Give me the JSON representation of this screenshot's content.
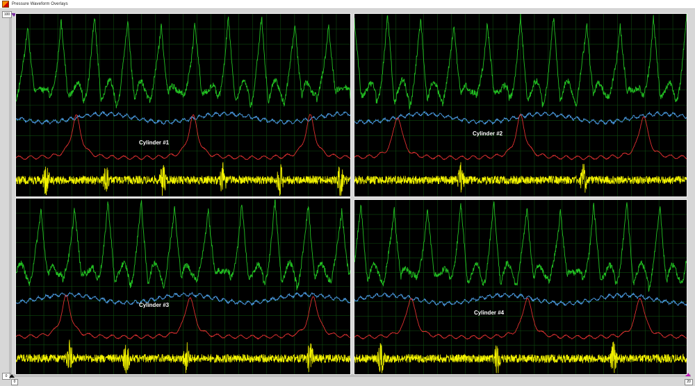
{
  "window": {
    "title": "Pressure Waveform Overlays"
  },
  "controls": {
    "top_left_value": "100",
    "bottom_left_value": "0",
    "bottom_left_small": "0",
    "bottom_right_value": "20"
  },
  "colors": {
    "background": "#000000",
    "grid": "#0f4a0f",
    "cylinder_pressure": "#22c222",
    "intake_trace": "#4a9ae0",
    "ignition_trace": "#e03030",
    "vibration_trace": "#f4f400"
  },
  "panels": [
    {
      "label": "Cylinder #1",
      "phase": 0.0,
      "green_cycles": 10,
      "red_peaks": [
        0.18,
        0.53,
        0.88
      ],
      "yellow_spikes": [
        0.09,
        0.27,
        0.44,
        0.62,
        0.79,
        0.97
      ]
    },
    {
      "label": "Cylinder #2",
      "phase": 0.35,
      "green_cycles": 10,
      "red_peaks": [
        0.13,
        0.5,
        0.87
      ],
      "yellow_spikes": [
        0.32,
        0.69
      ]
    },
    {
      "label": "Cylinder #3",
      "phase": 0.6,
      "green_cycles": 10,
      "red_peaks": [
        0.15,
        0.52,
        0.89
      ],
      "yellow_spikes": [
        0.16,
        0.33,
        0.51,
        0.88
      ]
    },
    {
      "label": "Cylinder #4",
      "phase": 0.15,
      "green_cycles": 10,
      "red_peaks": [
        0.17,
        0.52,
        0.86
      ],
      "yellow_spikes": [
        0.08,
        0.43,
        0.78
      ]
    }
  ]
}
